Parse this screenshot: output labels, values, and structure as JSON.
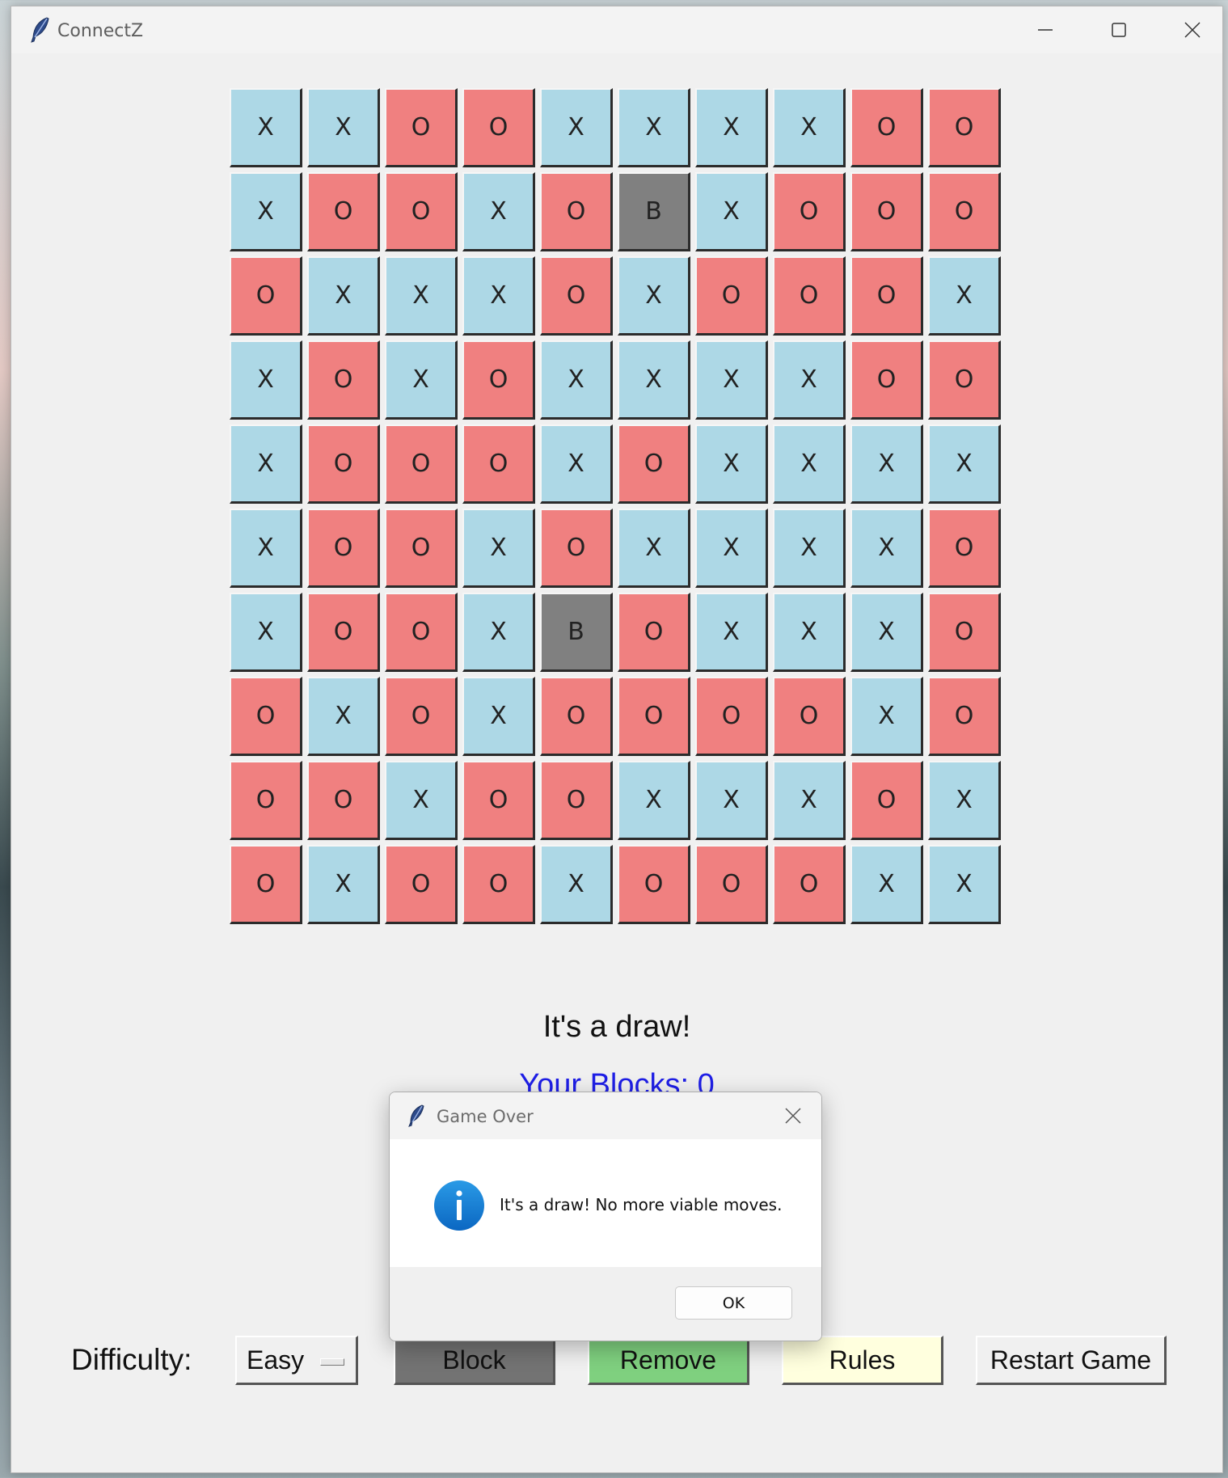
{
  "window": {
    "title": "ConnectZ"
  },
  "board": {
    "rows": [
      [
        "X",
        "X",
        "O",
        "O",
        "X",
        "X",
        "X",
        "X",
        "O",
        "O"
      ],
      [
        "X",
        "O",
        "O",
        "X",
        "O",
        "B",
        "X",
        "O",
        "O",
        "O"
      ],
      [
        "O",
        "X",
        "X",
        "X",
        "O",
        "X",
        "O",
        "O",
        "O",
        "X"
      ],
      [
        "X",
        "O",
        "X",
        "O",
        "X",
        "X",
        "X",
        "X",
        "O",
        "O"
      ],
      [
        "X",
        "O",
        "O",
        "O",
        "X",
        "O",
        "X",
        "X",
        "X",
        "X"
      ],
      [
        "X",
        "O",
        "O",
        "X",
        "O",
        "X",
        "X",
        "X",
        "X",
        "O"
      ],
      [
        "X",
        "O",
        "O",
        "X",
        "B",
        "O",
        "X",
        "X",
        "X",
        "O"
      ],
      [
        "O",
        "X",
        "O",
        "X",
        "O",
        "O",
        "O",
        "O",
        "X",
        "O"
      ],
      [
        "O",
        "O",
        "X",
        "O",
        "O",
        "X",
        "X",
        "X",
        "O",
        "X"
      ],
      [
        "O",
        "X",
        "O",
        "O",
        "X",
        "O",
        "O",
        "O",
        "X",
        "X"
      ]
    ],
    "colors": {
      "X": "#add8e6",
      "O": "#f08080",
      "B": "#808080"
    }
  },
  "status": {
    "message": "It's a draw!",
    "blocks": "Your Blocks: 0"
  },
  "controls": {
    "difficulty_label": "Difficulty:",
    "difficulty_value": "Easy",
    "block_label": "Block",
    "remove_label": "Remove",
    "rules_label": "Rules",
    "restart_label": "Restart Game"
  },
  "dialog": {
    "title": "Game Over",
    "message": "It's a draw! No more viable moves.",
    "ok_label": "OK"
  }
}
